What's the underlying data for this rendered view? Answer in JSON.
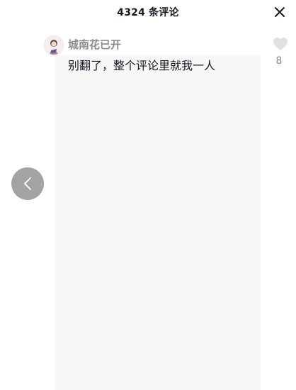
{
  "header": {
    "title": "4324 条评论"
  },
  "comments": [
    {
      "username": "城南花已开",
      "text": "别翻了，整个评论里就我一人",
      "like_count": "8"
    }
  ],
  "colors": {
    "username": "#8a8b91",
    "text": "#161823",
    "like_heart": "#e1e1e3",
    "back_button_bg": "#a3a3a6"
  },
  "icons": {
    "close": "close-icon",
    "like": "heart-icon",
    "back": "chevron-left-icon"
  }
}
